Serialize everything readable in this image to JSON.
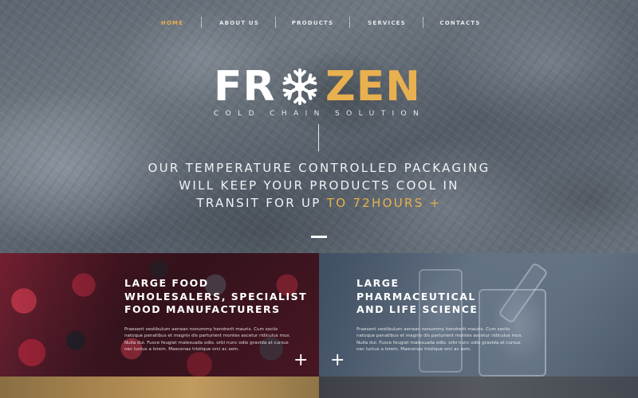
{
  "nav": {
    "items": [
      {
        "label": "HOME",
        "active": true
      },
      {
        "label": "ABOUT US",
        "active": false
      },
      {
        "label": "PRODUCTS",
        "active": false
      },
      {
        "label": "SERVICES",
        "active": false
      },
      {
        "label": "CONTACTS",
        "active": false
      }
    ]
  },
  "hero": {
    "logo_left": "FR",
    "logo_icon": "snowflake-icon",
    "logo_right": "ZEN",
    "tagline": "COLD CHAIN SOLUTION",
    "headline_line1": "OUR TEMPERATURE CONTROLLED PACKAGING",
    "headline_line2": "WILL KEEP YOUR PRODUCTS COOL IN",
    "headline_line3_plain": "TRANSIT FOR UP",
    "headline_line3_accent": "TO 72HOURS +"
  },
  "cards": [
    {
      "title_lines": [
        "LARGE FOOD",
        "WHOLESALERS, SPECIALIST",
        "FOOD MANUFACTURERS"
      ],
      "text_lines": [
        "Praesent vestibulum aenean nonummy hendrerit mauris. Cum sociis",
        "natoque penatibus et magnis dis parturient montes ascetur ridiculus mus.",
        "Nulla dui. Fusce feugiat malesuada odio. orbi nunc odio gravida at cursus",
        "nec luctus a lorem. Maecenas tristique orci ac sem."
      ],
      "plus": "+"
    },
    {
      "title_lines": [
        "LARGE",
        "PHARMACEUTICAL",
        "AND LIFE SCIENCE"
      ],
      "text_lines": [
        "Praesent vestibulum aenean nonummy hendrerit mauris. Cum sociis",
        "natoque penatibus et magnis dis parturient montes ascetur ridiculus mus.",
        "Nulla dui. Fusce feugiat malesuada odio. orbi nunc odio gravida at cursus",
        "nec luctus a lorem. Maecenas tristique orci ac sem."
      ],
      "plus": "+"
    }
  ],
  "colors": {
    "accent": "#e8b04f",
    "text": "#ffffff"
  }
}
